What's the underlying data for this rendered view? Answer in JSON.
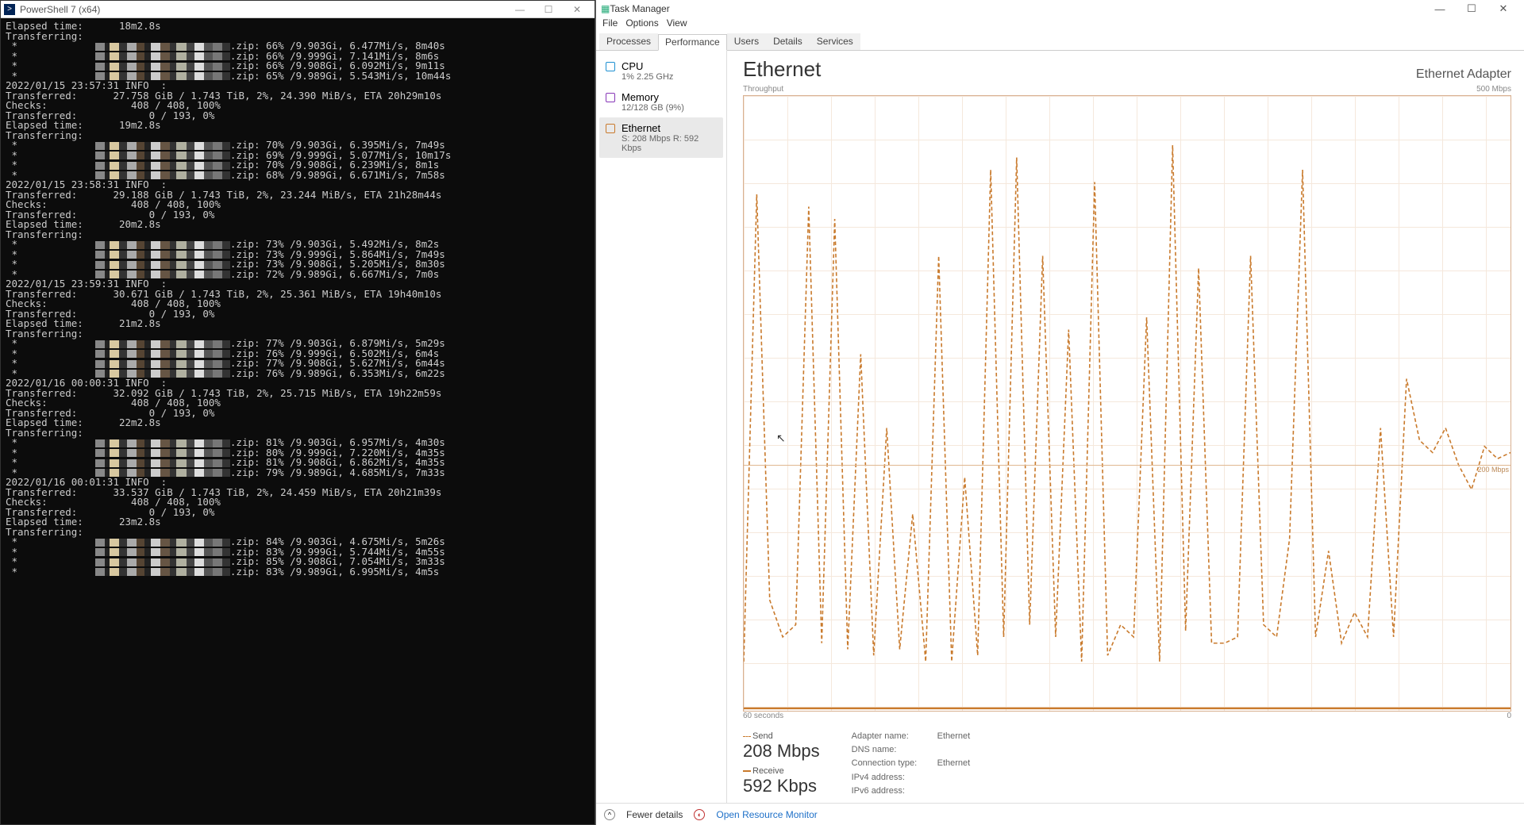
{
  "powershell": {
    "title": "PowerShell 7 (x64)",
    "blocks": [
      {
        "pre": [
          "Elapsed time:      18m2.8s",
          "Transferring:"
        ],
        "files": [
          ".zip: 66% /9.903Gi, 6.477Mi/s, 8m40s",
          ".zip: 66% /9.999Gi, 7.141Mi/s, 8m6s",
          ".zip: 66% /9.908Gi, 6.092Mi/s, 9m11s",
          ".zip: 65% /9.989Gi, 5.543Mi/s, 10m44s"
        ]
      },
      {
        "header": "2022/01/15 23:57:31 INFO  :",
        "stats": [
          "Transferred:      27.758 GiB / 1.743 TiB, 2%, 24.390 MiB/s, ETA 20h29m10s",
          "Checks:              408 / 408, 100%",
          "Transferred:            0 / 193, 0%",
          "Elapsed time:      19m2.8s",
          "Transferring:"
        ],
        "files": [
          ".zip: 70% /9.903Gi, 6.395Mi/s, 7m49s",
          ".zip: 69% /9.999Gi, 5.077Mi/s, 10m17s",
          ".zip: 70% /9.908Gi, 6.239Mi/s, 8m1s",
          ".zip: 68% /9.989Gi, 6.671Mi/s, 7m58s"
        ]
      },
      {
        "header": "2022/01/15 23:58:31 INFO  :",
        "stats": [
          "Transferred:      29.188 GiB / 1.743 TiB, 2%, 23.244 MiB/s, ETA 21h28m44s",
          "Checks:              408 / 408, 100%",
          "Transferred:            0 / 193, 0%",
          "Elapsed time:      20m2.8s",
          "Transferring:"
        ],
        "files": [
          ".zip: 73% /9.903Gi, 5.492Mi/s, 8m2s",
          ".zip: 73% /9.999Gi, 5.864Mi/s, 7m49s",
          ".zip: 73% /9.908Gi, 5.205Mi/s, 8m30s",
          ".zip: 72% /9.989Gi, 6.667Mi/s, 7m0s"
        ]
      },
      {
        "header": "2022/01/15 23:59:31 INFO  :",
        "stats": [
          "Transferred:      30.671 GiB / 1.743 TiB, 2%, 25.361 MiB/s, ETA 19h40m10s",
          "Checks:              408 / 408, 100%",
          "Transferred:            0 / 193, 0%",
          "Elapsed time:      21m2.8s",
          "Transferring:"
        ],
        "files": [
          ".zip: 77% /9.903Gi, 6.879Mi/s, 5m29s",
          ".zip: 76% /9.999Gi, 6.502Mi/s, 6m4s",
          ".zip: 77% /9.908Gi, 5.627Mi/s, 6m44s",
          ".zip: 76% /9.989Gi, 6.353Mi/s, 6m22s"
        ]
      },
      {
        "header": "2022/01/16 00:00:31 INFO  :",
        "stats": [
          "Transferred:      32.092 GiB / 1.743 TiB, 2%, 25.715 MiB/s, ETA 19h22m59s",
          "Checks:              408 / 408, 100%",
          "Transferred:            0 / 193, 0%",
          "Elapsed time:      22m2.8s",
          "Transferring:"
        ],
        "files": [
          ".zip: 81% /9.903Gi, 6.957Mi/s, 4m30s",
          ".zip: 80% /9.999Gi, 7.220Mi/s, 4m35s",
          ".zip: 81% /9.908Gi, 6.862Mi/s, 4m35s",
          ".zip: 79% /9.989Gi, 4.685Mi/s, 7m33s"
        ]
      },
      {
        "header": "2022/01/16 00:01:31 INFO  :",
        "stats": [
          "Transferred:      33.537 GiB / 1.743 TiB, 2%, 24.459 MiB/s, ETA 20h21m39s",
          "Checks:              408 / 408, 100%",
          "Transferred:            0 / 193, 0%",
          "Elapsed time:      23m2.8s",
          "Transferring:"
        ],
        "files": [
          ".zip: 84% /9.903Gi, 4.675Mi/s, 5m26s",
          ".zip: 83% /9.999Gi, 5.744Mi/s, 4m55s",
          ".zip: 85% /9.908Gi, 7.054Mi/s, 3m33s",
          ".zip: 83% /9.989Gi, 6.995Mi/s, 4m5s"
        ]
      }
    ]
  },
  "taskmgr": {
    "title": "Task Manager",
    "menu": [
      "File",
      "Options",
      "View"
    ],
    "tabs": [
      "Processes",
      "Performance",
      "Users",
      "Details",
      "Services"
    ],
    "active_tab": 1,
    "sidebar": [
      {
        "kind": "cpu",
        "name": "CPU",
        "sub": "1% 2.25 GHz"
      },
      {
        "kind": "mem",
        "name": "Memory",
        "sub": "12/128 GB (9%)"
      },
      {
        "kind": "eth",
        "name": "Ethernet",
        "sub": "S: 208 Mbps R: 592 Kbps"
      }
    ],
    "selected_sidebar": 2,
    "main": {
      "heading": "Ethernet",
      "adapter": "Ethernet Adapter",
      "y_label": "Throughput",
      "y_max": "500 Mbps",
      "mid_label": "200 Mbps",
      "x_left": "60 seconds",
      "x_right": "0",
      "send_label": "Send",
      "send_value": "208 Mbps",
      "recv_label": "Receive",
      "recv_value": "592 Kbps",
      "info": {
        "adapter_name_l": "Adapter name:",
        "adapter_name_v": "Ethernet",
        "dns_l": "DNS name:",
        "dns_v": "",
        "ctype_l": "Connection type:",
        "ctype_v": "Ethernet",
        "ipv4_l": "IPv4 address:",
        "ipv4_v": "",
        "ipv6_l": "IPv6 address:",
        "ipv6_v": ""
      }
    },
    "footer": {
      "fewer": "Fewer details",
      "rmon": "Open Resource Monitor"
    }
  },
  "chart_data": {
    "type": "line",
    "title": "Ethernet Throughput",
    "xlabel": "seconds",
    "ylabel": "Mbps",
    "xlim": [
      0,
      60
    ],
    "ylim": [
      0,
      500
    ],
    "series": [
      {
        "name": "Send",
        "values": [
          40,
          420,
          90,
          60,
          70,
          410,
          55,
          400,
          50,
          290,
          45,
          230,
          50,
          160,
          40,
          370,
          40,
          190,
          45,
          440,
          60,
          450,
          70,
          370,
          60,
          310,
          40,
          430,
          45,
          70,
          60,
          320,
          40,
          460,
          65,
          360,
          55,
          55,
          60,
          370,
          70,
          60,
          140,
          440,
          60,
          130,
          55,
          80,
          60,
          230,
          60,
          270,
          220,
          210,
          230,
          200,
          180,
          215,
          205,
          210
        ]
      },
      {
        "name": "Receive",
        "values": [
          2,
          2,
          2,
          2,
          2,
          2,
          2,
          2,
          2,
          2,
          2,
          2,
          2,
          2,
          2,
          2,
          2,
          2,
          2,
          2,
          2,
          2,
          2,
          2,
          2,
          2,
          2,
          2,
          2,
          2,
          2,
          2,
          2,
          2,
          2,
          2,
          2,
          2,
          2,
          2,
          2,
          2,
          2,
          2,
          2,
          2,
          2,
          2,
          2,
          2,
          2,
          2,
          2,
          2,
          2,
          2,
          2,
          2,
          2,
          2
        ]
      }
    ]
  }
}
